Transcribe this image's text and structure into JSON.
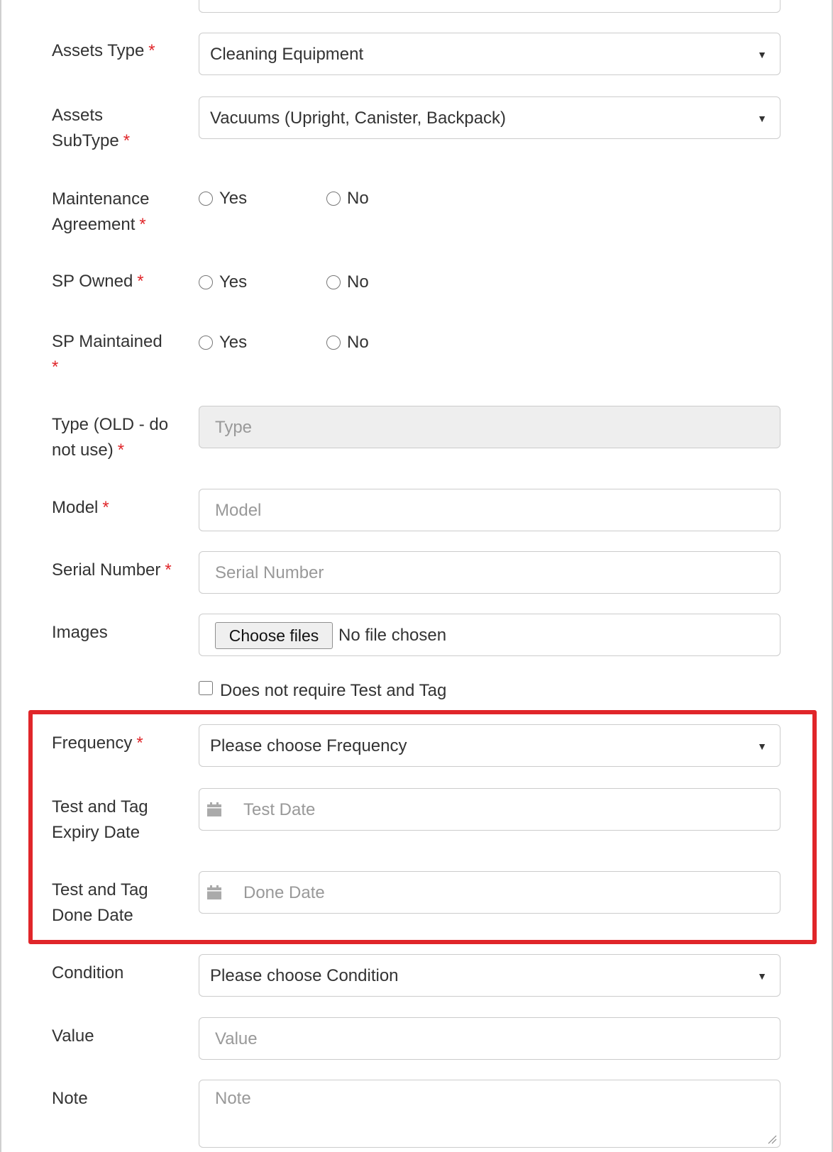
{
  "top_field": {
    "value": ""
  },
  "assets_type": {
    "label": "Assets Type",
    "required": "*",
    "value": "Cleaning Equipment",
    "caret": "▼"
  },
  "assets_subtype": {
    "label_line1": "Assets",
    "label_line2": "SubType",
    "required": "*",
    "value": "Vacuums (Upright, Canister, Backpack)",
    "caret": "▼"
  },
  "maintenance_agreement": {
    "label_line1": "Maintenance",
    "label_line2": "Agreement",
    "required": "*",
    "yes": "Yes",
    "no": "No"
  },
  "sp_owned": {
    "label": "SP Owned",
    "required": "*",
    "yes": "Yes",
    "no": "No"
  },
  "sp_maintained": {
    "label_line1": "SP Maintained",
    "required": "*",
    "yes": "Yes",
    "no": "No"
  },
  "type_old": {
    "label_line1": "Type (OLD - do",
    "label_line2": "not use)",
    "required": "*",
    "placeholder": "Type"
  },
  "model": {
    "label": "Model",
    "required": "*",
    "placeholder": "Model"
  },
  "serial_number": {
    "label": "Serial Number",
    "required": "*",
    "placeholder": "Serial Number"
  },
  "images": {
    "label": "Images",
    "button": "Choose files",
    "status": "No file chosen"
  },
  "test_and_tag_checkbox": {
    "label": "Does not require Test and Tag"
  },
  "frequency": {
    "label": "Frequency",
    "required": "*",
    "value": "Please choose Frequency",
    "caret": "▼"
  },
  "expiry_date": {
    "label_line1": "Test and Tag",
    "label_line2": "Expiry Date",
    "placeholder": "Test Date",
    "icon": "calendar-icon"
  },
  "done_date": {
    "label_line1": "Test and Tag",
    "label_line2": "Done Date",
    "placeholder": "Done Date",
    "icon": "calendar-icon"
  },
  "condition": {
    "label": "Condition",
    "value": "Please choose Condition",
    "caret": "▼"
  },
  "value_field": {
    "label": "Value",
    "placeholder": "Value"
  },
  "note": {
    "label": "Note",
    "placeholder": "Note"
  },
  "colors": {
    "required": "#e0262a",
    "highlight": "#e0262a",
    "border": "#cccccc",
    "disabled_bg": "#eeeeee"
  }
}
